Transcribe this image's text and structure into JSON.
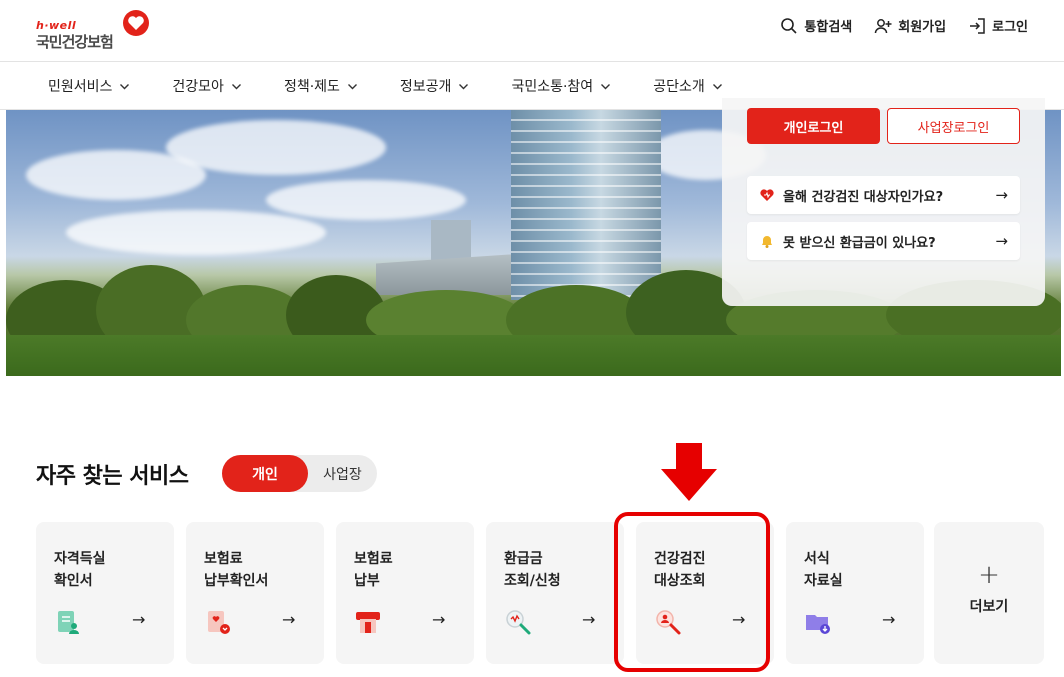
{
  "header": {
    "logo_small": "h·well",
    "logo_main": "국민건강보험",
    "links": [
      {
        "label": "통합검색",
        "icon": "search-icon"
      },
      {
        "label": "회원가입",
        "icon": "user-add-icon"
      },
      {
        "label": "로그인",
        "icon": "login-icon"
      }
    ]
  },
  "nav": {
    "items": [
      "민원서비스",
      "건강모아",
      "정책·제도",
      "정보공개",
      "국민소통·참여",
      "공단소개"
    ]
  },
  "hero": {
    "login_personal": "개인로그인",
    "login_business": "사업장로그인",
    "quick_links": [
      {
        "label": "올해 건강검진 대상자인가요?",
        "icon": "heart-icon",
        "arrow": "→"
      },
      {
        "label": "못 받으신 환급금이 있나요?",
        "icon": "bell-icon",
        "arrow": "→"
      }
    ]
  },
  "services": {
    "title": "자주 찾는 서비스",
    "toggle_on": "개인",
    "toggle_off": "사업장",
    "cards": [
      {
        "label": "자격득실\n확인서",
        "icon": "document-user-icon",
        "arrow": "→"
      },
      {
        "label": "보험료\n납부확인서",
        "icon": "document-heart-icon",
        "arrow": "→"
      },
      {
        "label": "보험료\n납부",
        "icon": "payment-icon",
        "arrow": "→"
      },
      {
        "label": "환급금\n조회/신청",
        "icon": "search-refund-icon",
        "arrow": "→"
      },
      {
        "label": "건강검진\n대상조회",
        "icon": "search-person-icon",
        "arrow": "→"
      },
      {
        "label": "서식\n자료실",
        "icon": "folder-download-icon",
        "arrow": "→"
      }
    ],
    "more_label": "더보기",
    "more_icon": "plus-icon"
  },
  "colors": {
    "brand_red": "#e2231a",
    "annotation_red": "#e60000"
  }
}
